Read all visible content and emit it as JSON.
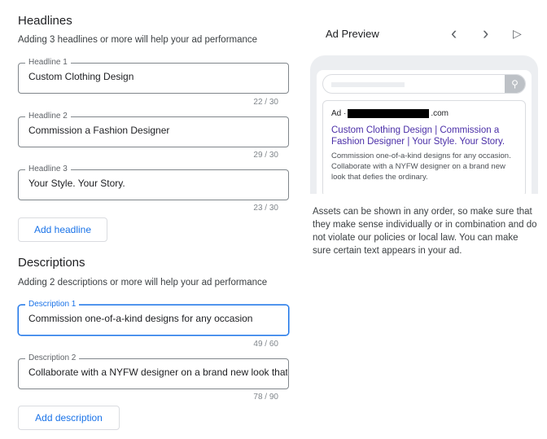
{
  "headlines": {
    "title": "Headlines",
    "subtitle": "Adding 3 headlines or more will help your ad performance",
    "fields": [
      {
        "label": "Headline 1",
        "value": "Custom Clothing Design",
        "count": "22 / 30"
      },
      {
        "label": "Headline 2",
        "value": "Commission a Fashion Designer",
        "count": "29 / 30"
      },
      {
        "label": "Headline 3",
        "value": "Your Style. Your Story.",
        "count": "23 / 30"
      }
    ],
    "add_label": "Add headline"
  },
  "descriptions": {
    "title": "Descriptions",
    "subtitle": "Adding 2 descriptions or more will help your ad performance",
    "fields": [
      {
        "label": "Description 1",
        "value": "Commission one-of-a-kind designs for any occasion",
        "count": "49 / 60"
      },
      {
        "label": "Description 2",
        "value": "Collaborate with a NYFW designer on a brand new look that defies the ordinary.",
        "count": "78 / 90"
      }
    ],
    "add_label": "Add description"
  },
  "preview": {
    "title": "Ad Preview",
    "prev": "‹",
    "next": "›",
    "play": "▷",
    "ad_prefix": "Ad ·",
    "domain_suffix": ".com",
    "ad_title": "Custom Clothing Design | Commission a Fashion Designer | Your Style. Your Story.",
    "ad_desc": "Commission one-of-a-kind designs for any occasion. Collaborate with a NYFW designer on a brand new look that defies the ordinary.",
    "note": "Assets can be shown in any order, so make sure that they make sense individually or in combination and do not violate our policies or local law. You can make sure certain text appears in your ad."
  },
  "colors": {
    "accent": "#1a73e8",
    "ad_title": "#4b2fa8"
  }
}
